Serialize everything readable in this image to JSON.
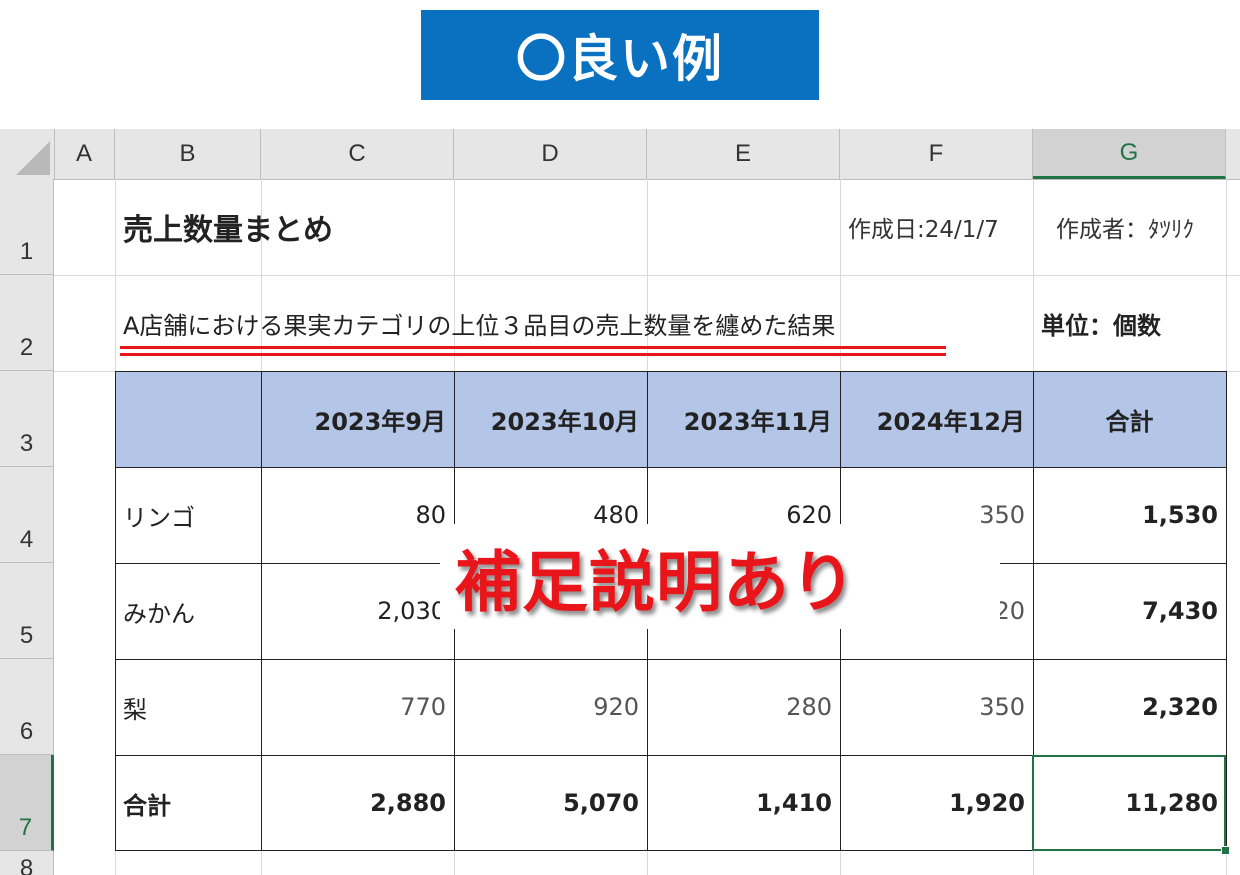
{
  "banner": {
    "label": "〇良い例",
    "color": "#0a70c0"
  },
  "sheet": {
    "columns": [
      "A",
      "B",
      "C",
      "D",
      "E",
      "F",
      "G"
    ],
    "selected_column": "G",
    "rows": [
      "1",
      "2",
      "3",
      "4",
      "5",
      "6",
      "7",
      "8"
    ],
    "selected_row": "7",
    "title": "売上数量まとめ",
    "created_date": "作成日:24/1/7",
    "author": "作成者：ﾀﾂﾘｸ",
    "description": "A店舗における果実カテゴリの上位３品目の売上数量を纏めた結果",
    "unit": "単位：個数",
    "table": {
      "header": [
        "",
        "2023年9月",
        "2023年10月",
        "2023年11月",
        "2024年12月",
        "合計"
      ],
      "rows": [
        [
          "リンゴ",
          "80",
          "480",
          "620",
          "350",
          "1,530"
        ],
        [
          "みかん",
          "2,030",
          "",
          "",
          "20",
          "7,430"
        ],
        [
          "梨",
          "770",
          "920",
          "280",
          "350",
          "2,320"
        ],
        [
          "合計",
          "2,880",
          "5,070",
          "1,410",
          "1,920",
          "11,280"
        ]
      ],
      "header_fill": "#b4c6e7"
    },
    "accent": "#217346"
  },
  "annotation": {
    "text": "補足説明あり",
    "color": "#e8151a"
  }
}
